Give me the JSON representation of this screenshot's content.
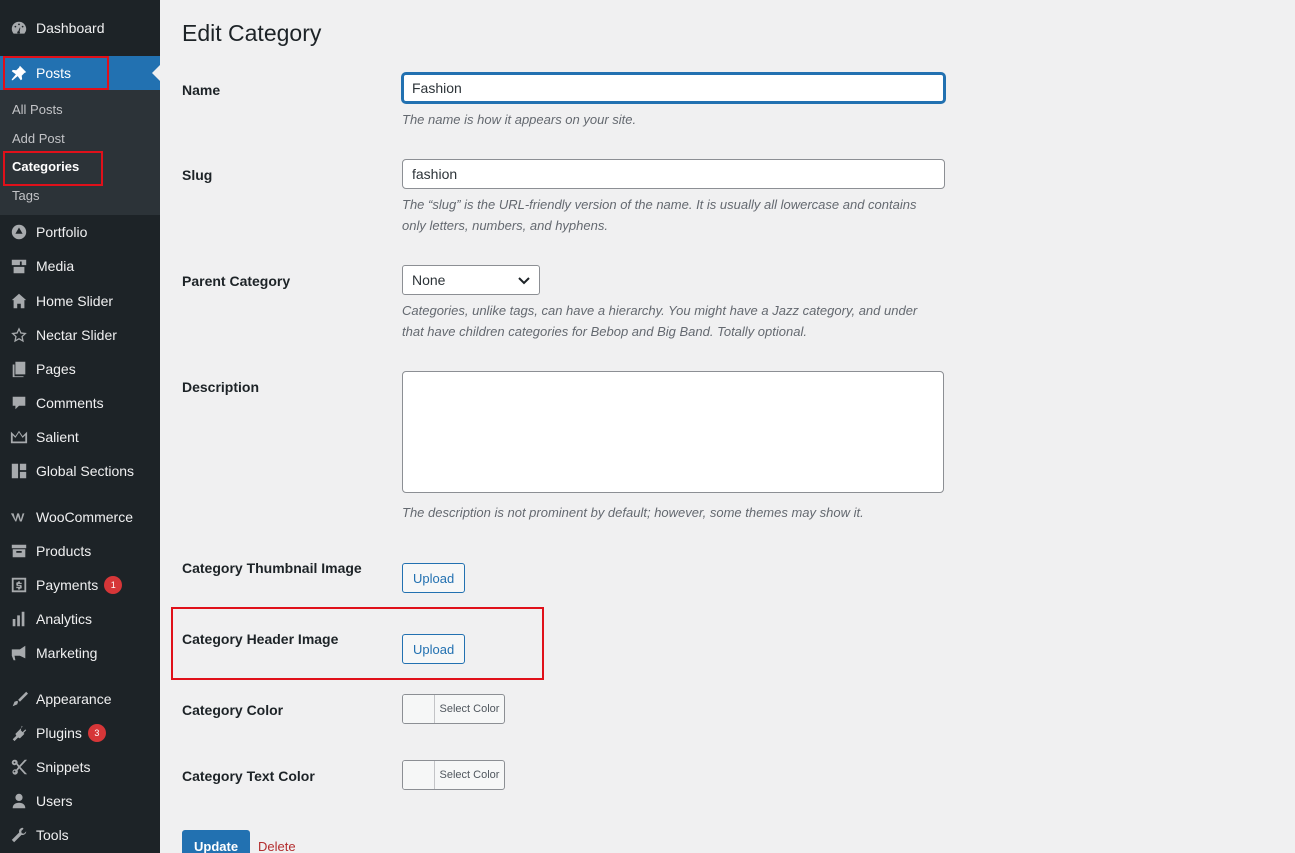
{
  "sidebar": {
    "menu": [
      {
        "label": "Dashboard",
        "icon": "dashboard-icon"
      },
      {
        "label": "Posts",
        "icon": "pin-icon"
      },
      {
        "label": "Portfolio",
        "icon": "portfolio-icon"
      },
      {
        "label": "Media",
        "icon": "media-icon"
      },
      {
        "label": "Home Slider",
        "icon": "home-icon"
      },
      {
        "label": "Nectar Slider",
        "icon": "star-icon"
      },
      {
        "label": "Pages",
        "icon": "pages-icon"
      },
      {
        "label": "Comments",
        "icon": "comment-icon"
      },
      {
        "label": "Salient",
        "icon": "crown-icon"
      },
      {
        "label": "Global Sections",
        "icon": "layout-icon"
      },
      {
        "label": "WooCommerce",
        "icon": "woo-icon"
      },
      {
        "label": "Products",
        "icon": "archive-icon"
      },
      {
        "label": "Payments",
        "icon": "payments-icon",
        "badge": "1"
      },
      {
        "label": "Analytics",
        "icon": "bar-chart-icon"
      },
      {
        "label": "Marketing",
        "icon": "megaphone-icon"
      },
      {
        "label": "Appearance",
        "icon": "paint-brush-icon"
      },
      {
        "label": "Plugins",
        "icon": "plugin-icon",
        "badge": "3"
      },
      {
        "label": "Snippets",
        "icon": "scissors-icon"
      },
      {
        "label": "Users",
        "icon": "user-icon"
      },
      {
        "label": "Tools",
        "icon": "wrench-icon"
      }
    ],
    "submenu": [
      "All Posts",
      "Add Post",
      "Categories",
      "Tags"
    ]
  },
  "main": {
    "title": "Edit Category",
    "name_label": "Name",
    "name_value": "Fashion",
    "name_hint": "The name is how it appears on your site.",
    "slug_label": "Slug",
    "slug_value": "fashion",
    "slug_hint_1": "The “slug” is the URL-friendly version of the name. It is usually all lowercase and contains",
    "slug_hint_2": "only letters, numbers, and hyphens.",
    "parent_label": "Parent Category",
    "parent_value": "None",
    "parent_hint_1": "Categories, unlike tags, can have a hierarchy. You might have a Jazz category, and under",
    "parent_hint_2": "that have children categories for Bebop and Big Band. Totally optional.",
    "description_label": "Description",
    "description_hint": "The description is not prominent by default; however, some themes may show it.",
    "thumb_label": "Category Thumbnail Image",
    "thumb_button": "Upload",
    "header_label": "Category Header Image",
    "header_button": "Upload",
    "color_label": "Category Color",
    "color_button": "Select Color",
    "text_color_label": "Category Text Color",
    "text_color_button": "Select Color",
    "update_button": "Update",
    "delete_link": "Delete"
  },
  "colors": {
    "sidebar_bg": "#1d2327",
    "accent": "#2271b1",
    "highlight_box": "#e0101a",
    "badge": "#d63638"
  }
}
